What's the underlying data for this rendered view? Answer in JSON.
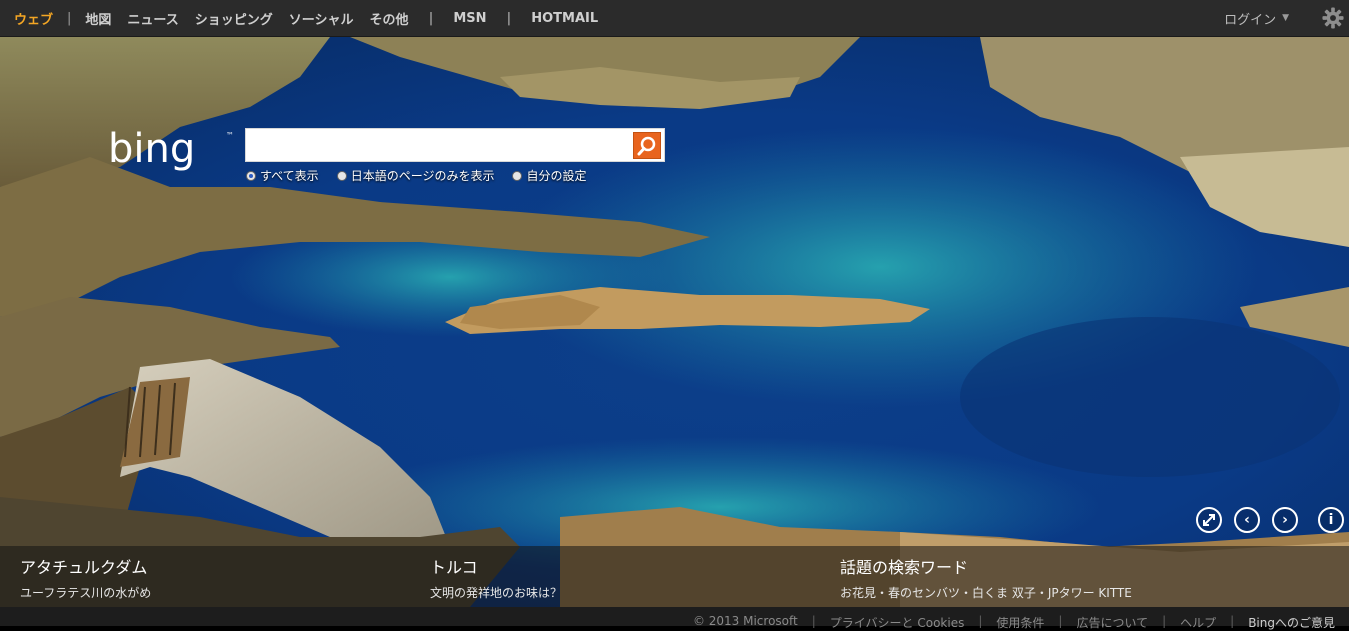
{
  "nav": {
    "items": [
      {
        "label": "ウェブ",
        "active": true
      },
      {
        "label": "地図"
      },
      {
        "label": "ニュース"
      },
      {
        "label": "ショッピング"
      },
      {
        "label": "ソーシャル"
      },
      {
        "label": "その他"
      },
      {
        "label": "MSN"
      },
      {
        "label": "HOTMAIL"
      }
    ],
    "login": "ログイン",
    "accent_color": "#f4a624"
  },
  "search": {
    "logo_text": "bing",
    "value": "",
    "options": [
      "すべて表示",
      "日本語のページのみを表示",
      "自分の設定"
    ],
    "selected_option": 0,
    "button_color": "#e8641e"
  },
  "controls": [
    "fullscreen-icon",
    "previous-icon",
    "next-icon",
    "info-icon"
  ],
  "info_panels": [
    {
      "title": "アタチュルクダム",
      "subtitle": "ユーフラテス川の水がめ"
    },
    {
      "title": "トルコ",
      "subtitle": "文明の発祥地のお味は？"
    },
    {
      "title": "話題の検索ワード",
      "subtitle": "お花見・春のセンバツ・白くま 双子・JPタワー KITTE"
    }
  ],
  "footer": {
    "links": [
      "© 2013 Microsoft",
      "プライバシーと Cookies",
      "使用条件",
      "広告について",
      "ヘルプ",
      "Bingへのご意見"
    ]
  }
}
